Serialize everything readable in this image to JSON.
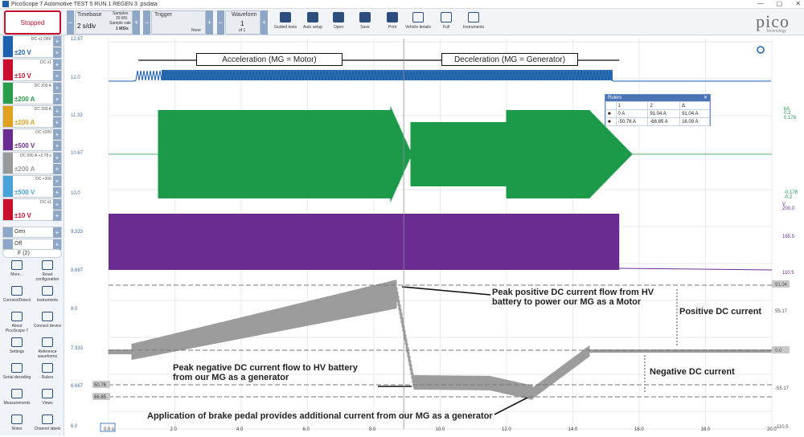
{
  "window": {
    "title": "PicoScope 7 Automotive TEST 5 RUN 1 REGEN 3 .psdata"
  },
  "toolbar": {
    "status": "Stopped",
    "timebase_label": "Timebase",
    "timebase_value": "2 s/div",
    "samples_label": "Samples",
    "samples_value": "20 MS",
    "sample_rate_label": "Sample rate",
    "sample_rate_value": "1 MS/s",
    "trigger_label": "Trigger",
    "trigger_mode": "None",
    "waveform_label": "Waveform",
    "waveform_index": "1",
    "waveform_total": "of 1",
    "tools": [
      "Guided tests",
      "Auto setup",
      "Open",
      "Save",
      "Print",
      "Vehicle details",
      "Full",
      "Instruments"
    ]
  },
  "logo": {
    "text": "pico",
    "sub": "Technology"
  },
  "channels": [
    {
      "id": "A",
      "range": "±20 V",
      "coupling": "DC x1 OFF",
      "color": "#2060b0"
    },
    {
      "id": "B",
      "range": "±10 V",
      "coupling": "DC x1",
      "color": "#c8102e"
    },
    {
      "id": "C",
      "range": "±200 A",
      "coupling": "DC 200 A",
      "color": "#2a9d4a"
    },
    {
      "id": "D",
      "range": "±200 A",
      "coupling": "DC 200 A",
      "color": "#e0a020"
    },
    {
      "id": "E",
      "range": "±500 V",
      "coupling": "DC ±200",
      "color": "#6a2c91"
    },
    {
      "id": "F",
      "range": "±200 A",
      "coupling": "DC 600 A +2.78 s",
      "color": "#9a9a9a"
    },
    {
      "id": "G",
      "range": "±500 V",
      "coupling": "DC +200",
      "color": "#4aa3d8"
    },
    {
      "id": "H",
      "range": "±10 V",
      "coupling": "DC x1",
      "color": "#c8102e"
    }
  ],
  "gen": {
    "label": "Gen",
    "value": "Off"
  },
  "math": {
    "label": "F (2)"
  },
  "left_tools": [
    "More...",
    "Reset configuration",
    "Connect/Detect",
    "Instruments",
    "About PicoScope 7",
    "Connect device",
    "Settings",
    "Reference waveforms",
    "Serial decoding",
    "Rulers",
    "Measurements",
    "Views",
    "Notes",
    "Channel labels"
  ],
  "left_scale": [
    "12.67",
    "12.0",
    "11.33",
    "10.67",
    "10.0",
    "9.333",
    "8.667",
    "8.0",
    "7.333",
    "6.667",
    "6.0"
  ],
  "x_ticks": [
    "0.0 s",
    "2.0",
    "4.0",
    "6.0",
    "8.0",
    "10.0",
    "12.0",
    "14.0",
    "16.0",
    "18.0",
    "20.0"
  ],
  "right_scale_c": [
    "kA",
    "0.2",
    "0.178",
    "-0.178",
    "-0.2"
  ],
  "right_scale_e": [
    "V",
    "200.0",
    "165.5",
    "110.5"
  ],
  "right_scale_f": [
    "91.04",
    "55.17",
    "0.0",
    "-55.17",
    "-110.5"
  ],
  "ruler_labels_left": [
    "50.76",
    "66.85"
  ],
  "headers": {
    "accel": "Acceleration (MG = Motor)",
    "decel": "Deceleration (MG = Generator)"
  },
  "annotations": {
    "peak_pos": "Peak positive DC current flow from HV battery to power our MG as a Motor",
    "pos_dc": "Positive DC current",
    "neg_dc": "Negative DC current",
    "peak_neg": "Peak negative  DC current flow to HV battery from our MG as a generator",
    "brake": "Application of brake pedal provides additional current from our MG as a generator"
  },
  "rulers_table": {
    "title": "Rulers",
    "cols": [
      "",
      "1",
      "2",
      "Δ"
    ],
    "rows": [
      [
        "■",
        "0 A",
        "91.04 A",
        "91.04 A"
      ],
      [
        "■",
        "-50.76 A",
        "-66.85 A",
        "16.09 A"
      ]
    ]
  },
  "colors": {
    "green": "#1c9a4a",
    "purple": "#6a2c91",
    "blue": "#1a5fa8",
    "gray": "#9c9c9c"
  }
}
